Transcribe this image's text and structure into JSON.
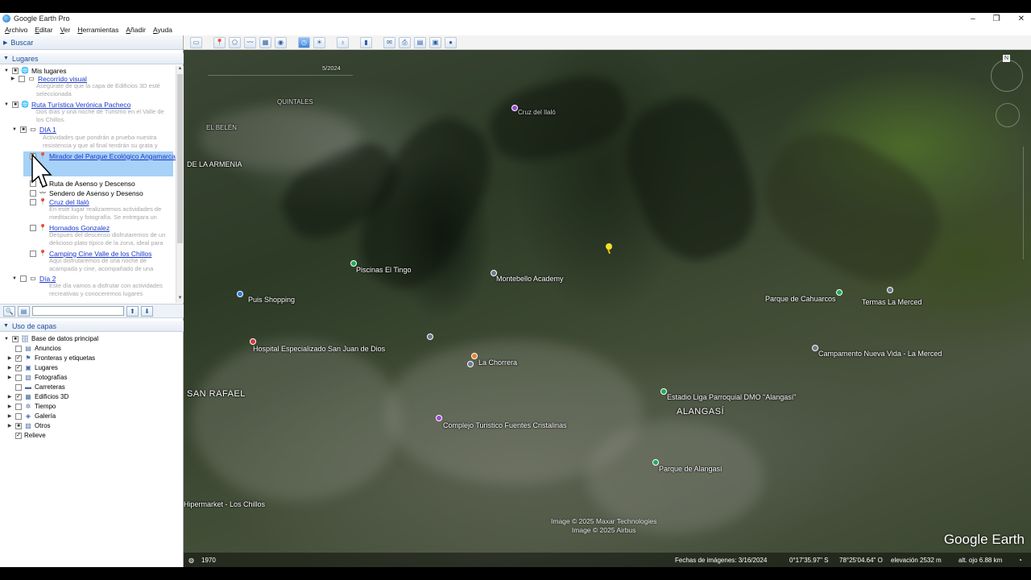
{
  "window": {
    "title": "Google Earth Pro",
    "controls": [
      "–",
      "❐",
      "✕"
    ]
  },
  "menu": [
    "Archivo",
    "Editar",
    "Ver",
    "Herramientas",
    "Añadir",
    "Ayuda"
  ],
  "toolbar": {
    "icons": [
      "sidebar-toggle-icon",
      "placemark-icon",
      "polygon-icon",
      "path-icon",
      "image-overlay-icon",
      "tour-record-icon",
      "historical-imagery-icon",
      "sun-icon",
      "planets-icon",
      "ruler-icon",
      "email-icon",
      "print-icon",
      "save-image-icon",
      "maps-view-icon",
      "earth-view-icon"
    ]
  },
  "sidebar": {
    "search_label": "Buscar",
    "places_label": "Lugares",
    "layers_label": "Uso de capas",
    "places_tree": [
      {
        "label": "Mis lugares",
        "link": false,
        "checked": "partial",
        "depth": 0,
        "expander": "open"
      },
      {
        "label": "Recorrido visual",
        "link": true,
        "checked": "none",
        "depth": 1,
        "expander": "closed",
        "desc": "Asegúrate de que la capa de Edificios 3D esté seleccionada"
      },
      {
        "label": "Ruta Turística Verónica Pacheco",
        "link": true,
        "checked": "partial",
        "depth": 0,
        "expander": "open",
        "desc": "Dos días y una noche de Turismo en el Valle de los Chillos."
      },
      {
        "label": "DIA 1",
        "link": true,
        "checked": "partial",
        "depth": 1,
        "expander": "open",
        "desc": "Actividades que pondrán a prueba nuestra resistencia y que al final tendrán su grata y"
      },
      {
        "label": "Mirador del Parque Ecológico Angamarca",
        "link": true,
        "checked": "checked",
        "depth": 2,
        "selected": true
      },
      {
        "label": "Ruta de Asenso y Descenso",
        "link": false,
        "checked": "none",
        "depth": 2
      },
      {
        "label": "Sendero de Asenso y Desenso",
        "link": false,
        "checked": "none",
        "depth": 2
      },
      {
        "label": "Cruz del Ilaló",
        "link": true,
        "checked": "none",
        "depth": 2,
        "desc": "En este lugar realizaremos actividades de meditación y fotografía. Se entregara un"
      },
      {
        "label": "Hornados Gonzalez",
        "link": true,
        "checked": "none",
        "depth": 2,
        "desc": "Despues del descenso disfrutaremos de un delicioso plato típico de la zona, ideal para"
      },
      {
        "label": "Camping Cine Valle de los Chillos",
        "link": true,
        "checked": "none",
        "depth": 2,
        "desc": "Aquí disfrutaremos de una noche de acampada y cine, acompañado de una"
      },
      {
        "label": "Día 2",
        "link": true,
        "checked": "none",
        "depth": 1,
        "expander": "open",
        "desc": "Este día vamos a disfrutar con actividades recreativas y conoceremos lugares"
      }
    ],
    "layers_tree": [
      {
        "label": "Base de datos principal",
        "checked": "partial",
        "expander": "open",
        "icon": "database-icon"
      },
      {
        "label": "Anuncios",
        "checked": "none",
        "icon": "ads-icon"
      },
      {
        "label": "Fronteras y etiquetas",
        "checked": "checked",
        "expander": "closed",
        "icon": "borders-icon"
      },
      {
        "label": "Lugares",
        "checked": "checked",
        "expander": "closed",
        "icon": "places-icon"
      },
      {
        "label": "Fotografías",
        "checked": "none",
        "expander": "closed",
        "icon": "photos-icon"
      },
      {
        "label": "Carreteras",
        "checked": "none",
        "icon": "roads-icon"
      },
      {
        "label": "Edificios 3D",
        "checked": "checked",
        "expander": "closed",
        "icon": "buildings-icon"
      },
      {
        "label": "Tiempo",
        "checked": "none",
        "expander": "closed",
        "icon": "weather-icon"
      },
      {
        "label": "Galería",
        "checked": "none",
        "expander": "closed",
        "icon": "gallery-icon"
      },
      {
        "label": "Otros",
        "checked": "partial",
        "expander": "closed",
        "icon": "other-icon"
      },
      {
        "label": "Relieve",
        "checked": "checked",
        "icon": "terrain-icon"
      }
    ]
  },
  "map": {
    "time_label": "5/2024",
    "labels": [
      {
        "text": "QUINTALES",
        "cls": "dim"
      },
      {
        "text": "EL BELÉN",
        "cls": "dim"
      },
      {
        "text": "DE LA ARMENIA",
        "cls": ""
      },
      {
        "text": "Cruz del Ilaló",
        "cls": "dim"
      },
      {
        "text": "Piscinas El Tingo",
        "cls": ""
      },
      {
        "text": "Montebello Academy",
        "cls": ""
      },
      {
        "text": "Puis Shopping",
        "cls": ""
      },
      {
        "text": "Parque de Cahuarcos",
        "cls": ""
      },
      {
        "text": "Termas La Merced",
        "cls": ""
      },
      {
        "text": "Hospital Especializado San Juan de Dios",
        "cls": ""
      },
      {
        "text": "Campamento Nueva Vida - La Merced",
        "cls": ""
      },
      {
        "text": "La Chorrera",
        "cls": ""
      },
      {
        "text": "SAN RAFAEL",
        "cls": "big"
      },
      {
        "text": "Estadio Liga Parroquial DMO \"Alangasí\"",
        "cls": ""
      },
      {
        "text": "ALANGASÍ",
        "cls": "big"
      },
      {
        "text": "Complejo Turistico Fuentes Cristalinas",
        "cls": ""
      },
      {
        "text": "Parque de Alangasí",
        "cls": ""
      },
      {
        "text": "Hipermarket - Los Chillos",
        "cls": ""
      }
    ],
    "copyright": [
      "Image © 2025 Maxar Technologies",
      "Image © 2025 Airbus"
    ],
    "wordmark": "Google Earth",
    "status": {
      "year": "1970",
      "imagery_date": "Fechas de imágenes: 3/16/2024",
      "lat": "0°17'35.97\" S",
      "lon": "78°25'04.64\" O",
      "elevation": "elevación  2532 m",
      "eye_alt": "alt. ojo   6.88 km"
    }
  }
}
